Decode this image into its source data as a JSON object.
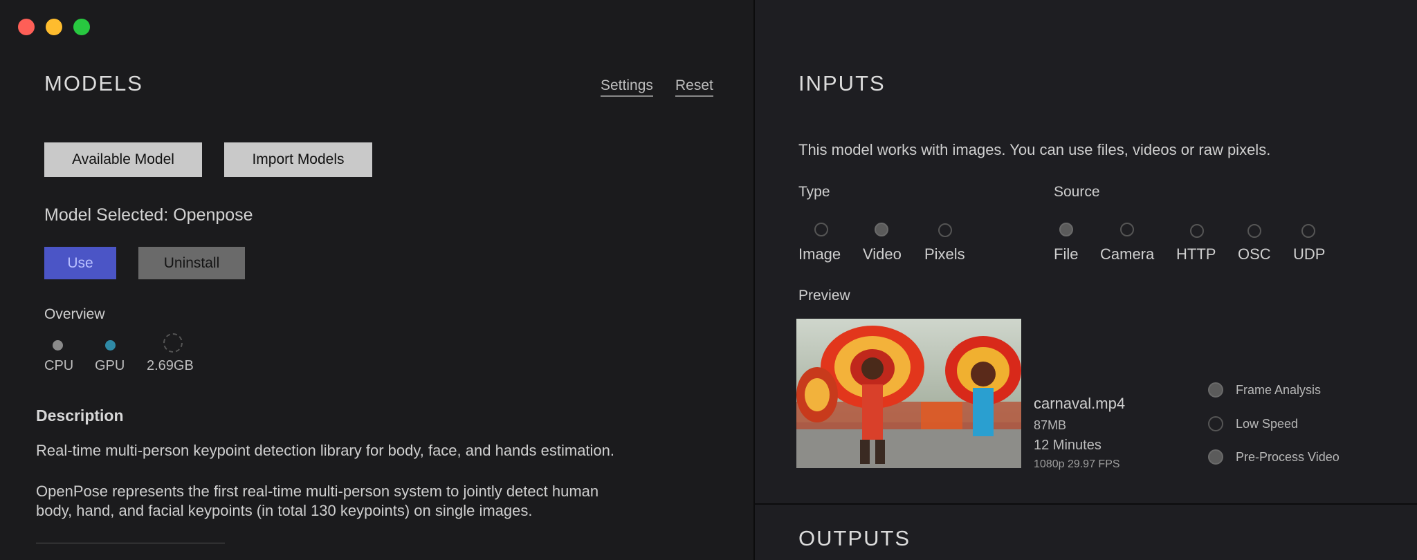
{
  "window_controls": {
    "close": "close",
    "minimize": "minimize",
    "zoom": "zoom"
  },
  "models": {
    "title": "MODELS",
    "settings": "Settings",
    "reset": "Reset",
    "available_button": "Available Model",
    "import_button": "Import Models",
    "selected": "Model Selected: Openpose",
    "use_button": "Use",
    "uninstall_button": "Uninstall",
    "overview_label": "Overview",
    "overview": [
      {
        "label": "CPU",
        "color": "#8a8a8a"
      },
      {
        "label": "GPU",
        "color": "#2f8aa6"
      },
      {
        "label": "2.69GB",
        "color": "#555555"
      }
    ],
    "description_title": "Description",
    "description_1": "Real-time multi-person keypoint detection library for body, face, and hands estimation.",
    "description_2a": "OpenPose represents the first real-time multi-person system to jointly detect human",
    "description_2b": "body, hand, and facial keypoints (in total 130 keypoints) on single images."
  },
  "inputs": {
    "title": "INPUTS",
    "intro": "This model works with images. You can use files, videos or raw pixels.",
    "type_label": "Type",
    "types": [
      {
        "label": "Image",
        "selected": false
      },
      {
        "label": "Video",
        "selected": true
      },
      {
        "label": "Pixels",
        "selected": false
      }
    ],
    "source_label": "Source",
    "sources": [
      {
        "label": "File",
        "selected": true
      },
      {
        "label": "Camera",
        "selected": false
      },
      {
        "label": "HTTP",
        "selected": false
      },
      {
        "label": "OSC",
        "selected": false
      },
      {
        "label": "UDP",
        "selected": false
      }
    ],
    "preview_label": "Preview",
    "file": {
      "name": "carnaval.mp4",
      "size": "87MB",
      "duration": "12 Minutes",
      "format": "1080p 29.97 FPS"
    },
    "options": [
      {
        "label": "Frame Analysis",
        "selected": true
      },
      {
        "label": "Low Speed",
        "selected": false
      },
      {
        "label": "Pre-Process Video",
        "selected": true
      }
    ]
  },
  "outputs": {
    "title": "OUTPUTS"
  },
  "colors": {
    "accent": "#4b55c6",
    "background": "#1d1d1f",
    "gpu": "#2f8aa6"
  }
}
